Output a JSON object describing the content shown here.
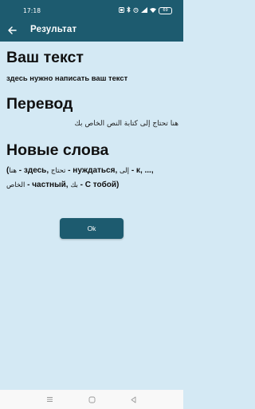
{
  "status_bar": {
    "time": "17:18",
    "battery": "69"
  },
  "app_bar": {
    "title": "Результат"
  },
  "sections": {
    "your_text_heading": "Ваш текст",
    "your_text_value": "здесь нужно написать ваш текст",
    "translation_heading": "Перевод",
    "translation_value": "هنا تحتاج إلى كتابة النص الخاص بك",
    "new_words_heading": "Новые слова"
  },
  "new_words": {
    "open_paren": "(",
    "w1_ar": "هنا",
    "w1_ru": " - здесь, ",
    "w2_ar": "تحتاج",
    "w2_ru": " - нуждаться, ",
    "w3_ar": "إلى",
    "w3_ru": " - к, ...,",
    "w4_ar": "الخاص",
    "w4_ru": " - частный, ",
    "w5_ar": "بك",
    "w5_ru": " - С тобой)"
  },
  "ok_button": {
    "label": "Ok"
  },
  "colors": {
    "primary": "#1d5b6f",
    "background": "#d4e9f4",
    "nav_bar": "#f8f8f8"
  },
  "icons": {
    "back": "arrow-left-icon",
    "nav_recents": "menu-lines-icon",
    "nav_home": "square-home-icon",
    "nav_back": "triangle-back-icon"
  }
}
